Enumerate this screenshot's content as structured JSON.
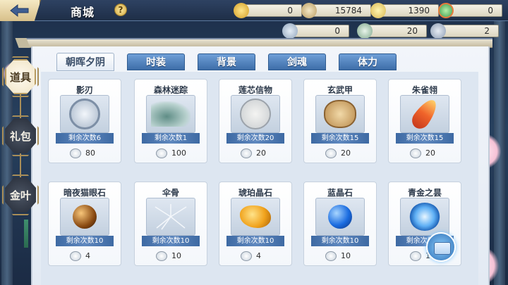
{
  "header": {
    "title": "商城",
    "help_label": "?",
    "currencies": [
      {
        "icon": "gold-ingot-icon",
        "value": "0"
      },
      {
        "icon": "scroll-icon",
        "value": "15784"
      },
      {
        "icon": "wand-icon",
        "value": "1390"
      },
      {
        "icon": "jade-coin-icon",
        "value": "0"
      }
    ],
    "sub_currencies": [
      {
        "icon": "coupon-icon",
        "value": "0"
      },
      {
        "icon": "leaf-icon",
        "value": "20"
      },
      {
        "icon": "ticket-icon",
        "value": "2"
      }
    ]
  },
  "tabs": [
    {
      "label": "朝晖夕阴",
      "active": true
    },
    {
      "label": "时装",
      "active": false
    },
    {
      "label": "背景",
      "active": false
    },
    {
      "label": "剑魂",
      "active": false
    },
    {
      "label": "体力",
      "active": false
    }
  ],
  "side_nav": [
    {
      "label": "道具",
      "active": true
    },
    {
      "label": "礼包",
      "active": false
    },
    {
      "label": "金叶",
      "active": false
    }
  ],
  "items": [
    {
      "name": "影刃",
      "remaining": "剩余次数6",
      "price": "80",
      "art": "mirror-icon"
    },
    {
      "name": "森林迷踪",
      "remaining": "剩余次数1",
      "price": "100",
      "art": "ink-landscape-icon"
    },
    {
      "name": "莲芯信物",
      "remaining": "剩余次数20",
      "price": "20",
      "art": "lotus-token-icon"
    },
    {
      "name": "玄武甲",
      "remaining": "剩余次数15",
      "price": "20",
      "art": "tortoise-shell-icon"
    },
    {
      "name": "朱雀翎",
      "remaining": "剩余次数15",
      "price": "20",
      "art": "phoenix-feather-icon"
    },
    {
      "name": "暗夜猫眼石",
      "remaining": "剩余次数10",
      "price": "4",
      "art": "cat-eye-stone-icon"
    },
    {
      "name": "伞骨",
      "remaining": "剩余次数10",
      "price": "10",
      "art": "umbrella-ribs-icon"
    },
    {
      "name": "琥珀晶石",
      "remaining": "剩余次数10",
      "price": "4",
      "art": "amber-crystal-icon"
    },
    {
      "name": "蓝晶石",
      "remaining": "剩余次数10",
      "price": "10",
      "art": "blue-crystal-orb-icon"
    },
    {
      "name": "青金之昙",
      "remaining": "剩余次数10",
      "price": "10",
      "art": "azure-flower-icon"
    }
  ],
  "colors": {
    "tab_blue": "#4d7fbd",
    "remain_bar": "#3e6aa3",
    "accent_gold": "#d8c08a"
  }
}
